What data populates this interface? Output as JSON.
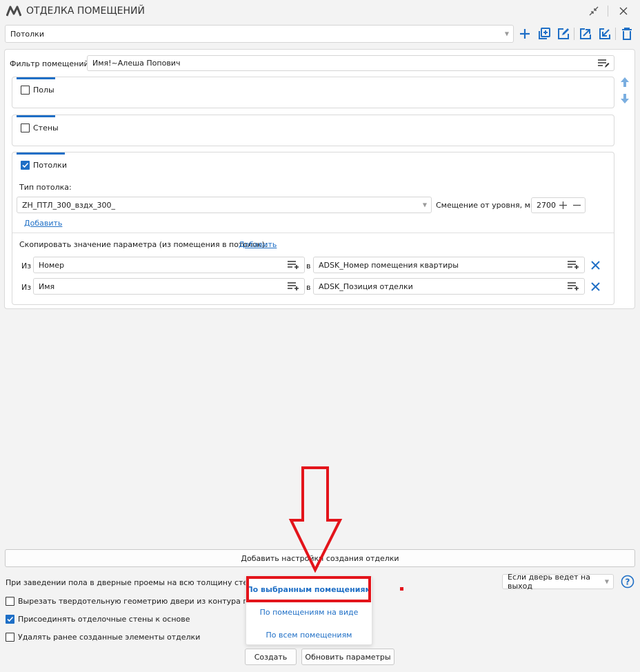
{
  "window": {
    "title": "ОТДЕЛКА ПОМЕЩЕНИЙ"
  },
  "toolbar": {
    "preset_value": "Потолки",
    "icons": [
      "add-icon",
      "copy-add-icon",
      "edit-icon",
      "export-icon",
      "import-icon",
      "trash-icon"
    ]
  },
  "filter": {
    "label": "Фильтр помещений:",
    "value": "Имя!~Алеша Попович"
  },
  "sections": {
    "floors": {
      "label": "Полы",
      "checked": false
    },
    "walls": {
      "label": "Стены",
      "checked": false
    },
    "ceilings": {
      "label": "Потолки",
      "checked": true,
      "type_label": "Тип потолка:",
      "type_value": "ZH_ПТЛ_300_вздх_300_",
      "offset_label": "Смещение от уровня, мм:",
      "offset_value": "2700",
      "add_link": "Добавить",
      "copy_label": "Скопировать значение параметра (из помещения в потолок):",
      "copy_link": "Добавить",
      "mappings": [
        {
          "from_label": "Из",
          "from": "Номер",
          "to_label": "в",
          "to": "ADSK_Номер помещения квартиры"
        },
        {
          "from_label": "Из",
          "from": "Имя",
          "to_label": "в",
          "to": "ADSK_Позиция отделки"
        }
      ]
    }
  },
  "add_settings_button": "Добавить настройки создания отделки",
  "door_text": "При заведении пола в дверные проемы на всю толщину стены счит",
  "door_select": "Если дверь ведет на выход",
  "options": [
    {
      "label": "Вырезать твердотельную геометрию двери из контура пола",
      "checked": false
    },
    {
      "label": "Присоединять отделочные стены к основе",
      "checked": true
    },
    {
      "label": "Удалять ранее созданные элементы отделки",
      "checked": false
    }
  ],
  "create_menu": [
    "По выбранным помещениям",
    "По помещениям на виде",
    "По всем помещениям"
  ],
  "footer": {
    "create": "Создать",
    "update": "Обновить параметры"
  },
  "colors": {
    "accent": "#1f6fc6",
    "highlight": "#e3141b"
  }
}
